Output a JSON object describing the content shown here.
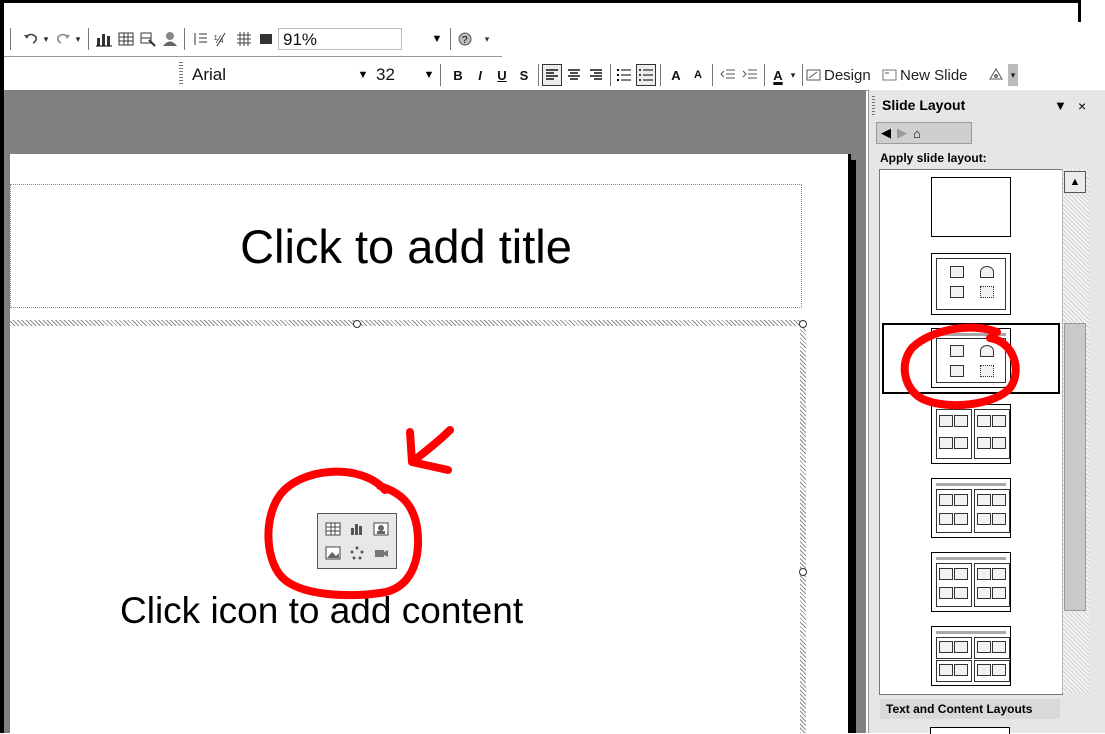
{
  "toolbar_standard": {
    "zoom_value": "91%",
    "icons": [
      "undo-icon",
      "redo-icon",
      "chart-icon",
      "table-icon",
      "tables-borders-icon",
      "insert-picture-icon",
      "expand-icon",
      "show-formatting-icon",
      "grid-icon",
      "color-grayscale-icon",
      "help-icon"
    ]
  },
  "toolbar_format": {
    "font_name": "Arial",
    "font_size": "32",
    "bold_label": "B",
    "italic_label": "I",
    "underline_label": "U",
    "shadow_label": "S",
    "grow_font_label": "A",
    "shrink_font_label": "A",
    "font_color_label": "A",
    "design_label": "Design",
    "new_slide_label": "New Slide"
  },
  "slide": {
    "title_placeholder": "Click to add title",
    "content_placeholder": "Click icon to add content"
  },
  "task_pane": {
    "title": "Slide Layout",
    "apply_label": "Apply slide layout:",
    "section_header": "Text and Content Layouts"
  },
  "colors": {
    "annotation_red": "#ff0000",
    "editor_gray": "#808080",
    "pane_gray": "#e6e6e6"
  }
}
